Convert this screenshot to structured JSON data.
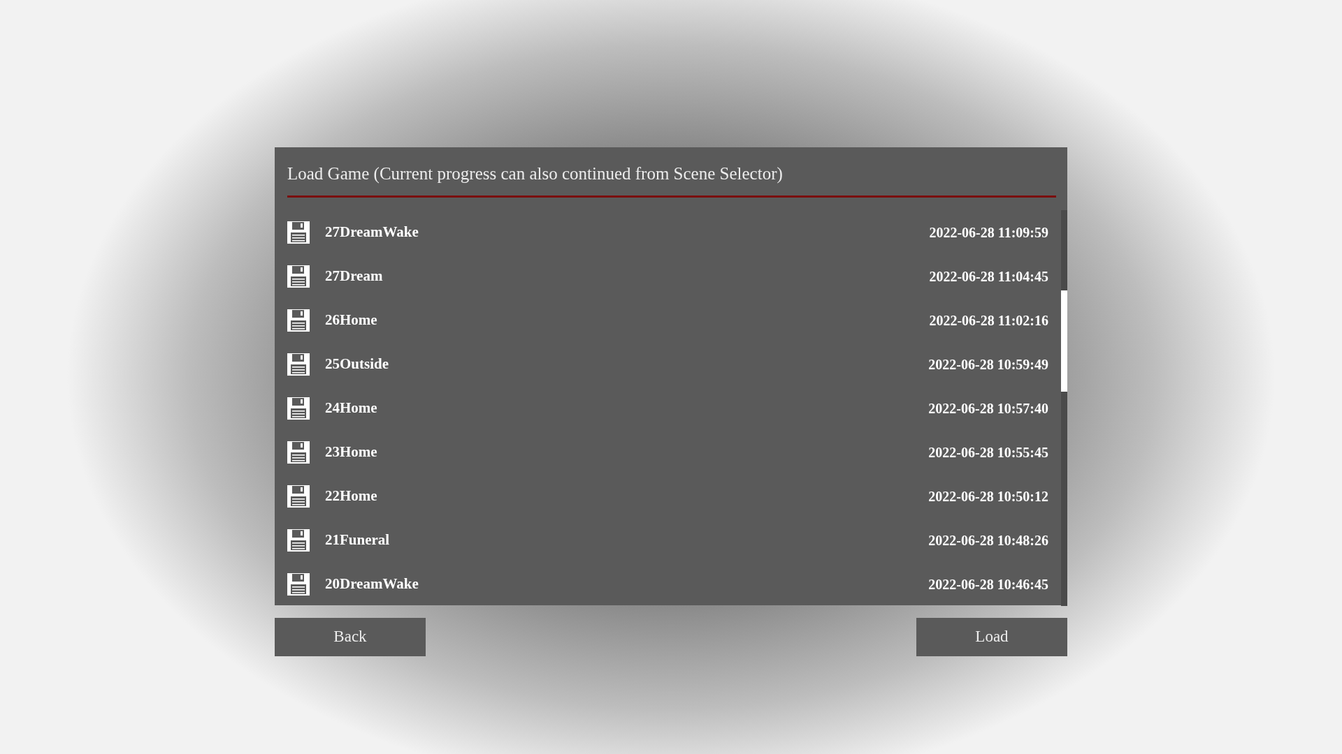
{
  "dialog": {
    "title": "Load Game (Current progress can also continued from Scene Selector)"
  },
  "saves": [
    {
      "name": "27DreamWake",
      "time": "2022-06-28 11:09:59"
    },
    {
      "name": "27Dream",
      "time": "2022-06-28 11:04:45"
    },
    {
      "name": "26Home",
      "time": "2022-06-28 11:02:16"
    },
    {
      "name": "25Outside",
      "time": "2022-06-28 10:59:49"
    },
    {
      "name": "24Home",
      "time": "2022-06-28 10:57:40"
    },
    {
      "name": "23Home",
      "time": "2022-06-28 10:55:45"
    },
    {
      "name": "22Home",
      "time": "2022-06-28 10:50:12"
    },
    {
      "name": "21Funeral",
      "time": "2022-06-28 10:48:26"
    },
    {
      "name": "20DreamWake",
      "time": "2022-06-28 10:46:45"
    }
  ],
  "buttons": [
    {
      "label": "Back"
    },
    {
      "label": "Load"
    }
  ]
}
